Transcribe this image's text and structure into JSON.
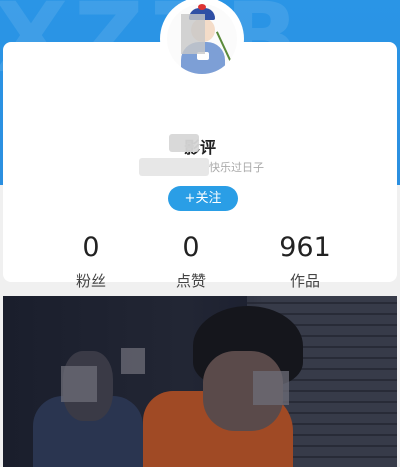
{
  "header": {
    "watermark": "XZZB"
  },
  "profile": {
    "name": "影评",
    "signature": "快乐过日子",
    "follow_label": "+关注"
  },
  "stats": [
    {
      "value": "0",
      "label": "粉丝"
    },
    {
      "value": "0",
      "label": "点赞"
    },
    {
      "value": "961",
      "label": "作品"
    }
  ],
  "colors": {
    "header_blue": "#2a95e6",
    "follow_button": "#2a9ee6",
    "card_background": "#ffffff",
    "page_background": "#f0f0f0"
  },
  "icons": {
    "avatar": "cartoon-avatar-image",
    "video": "video-thumbnail-image"
  }
}
